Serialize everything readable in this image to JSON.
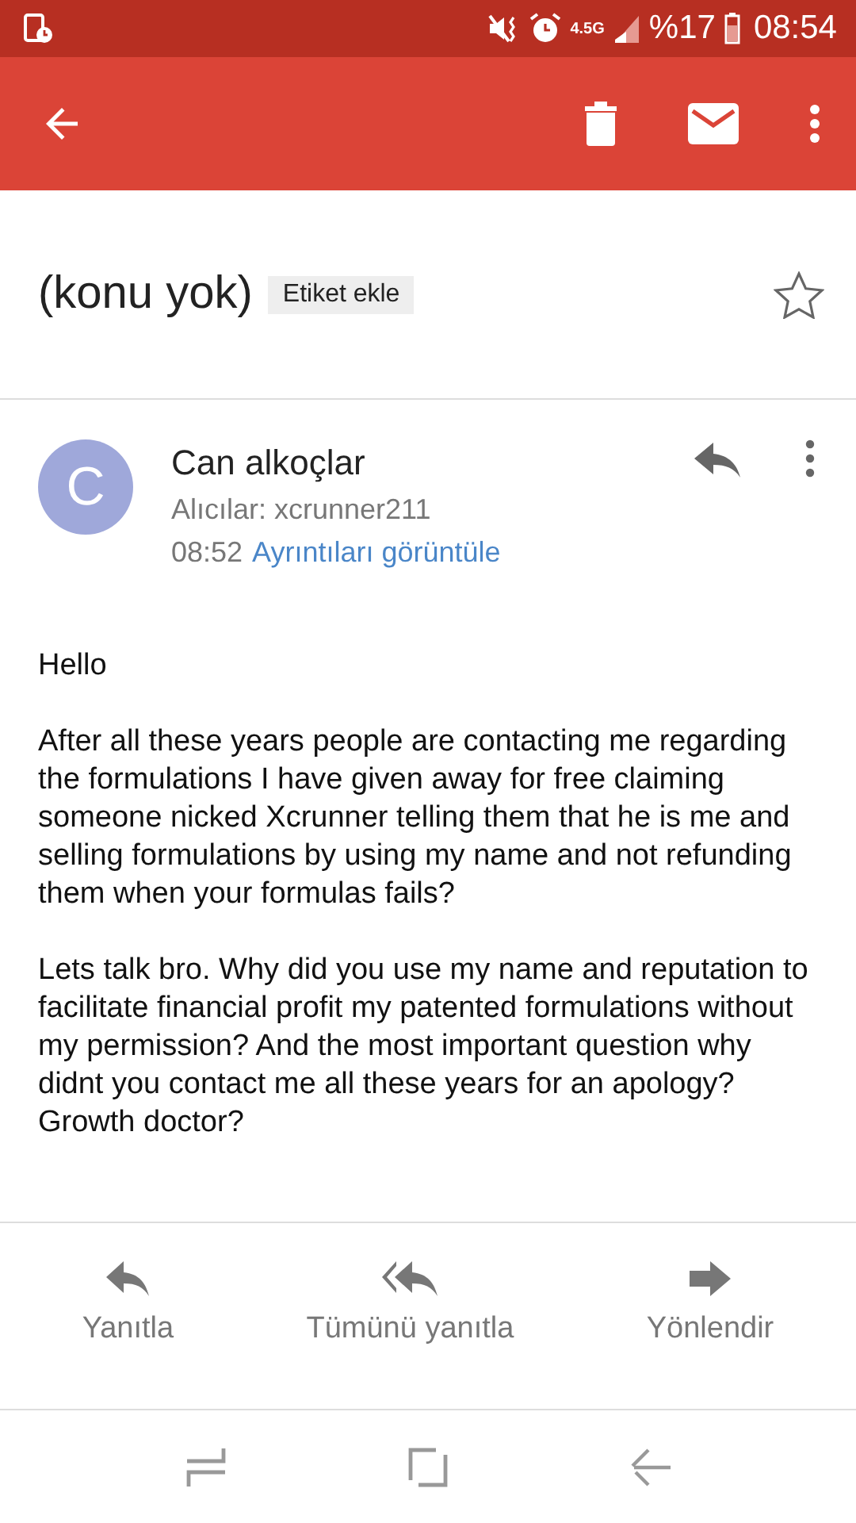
{
  "status_bar": {
    "network": "4.5G",
    "battery": "%17",
    "time": "08:54"
  },
  "subject": {
    "title": "(konu yok)",
    "label_button": "Etiket ekle",
    "starred": false
  },
  "message": {
    "avatar_letter": "C",
    "sender": "Can alkoçlar",
    "recipients": "Alıcılar: xcrunner211",
    "time": "08:52",
    "details_link": "Ayrıntıları görüntüle",
    "paragraphs": [
      "Hello",
      "After all these years people are contacting me regarding the formulations I have given away for free claiming someone nicked Xcrunner telling them that he is me and selling formulations by using my name and not refunding them when your formulas fails?",
      "Lets talk bro. Why did you use my name and reputation to facilitate financial profit my patented formulations without my permission? And the most important question why didnt you contact me all these years for an apology? Growth doctor?"
    ]
  },
  "actions": [
    {
      "kind": "reply",
      "label": "Yanıtla"
    },
    {
      "kind": "reply_all",
      "label": "Tümünü yanıtla"
    },
    {
      "kind": "forward",
      "label": "Yönlendir"
    }
  ]
}
